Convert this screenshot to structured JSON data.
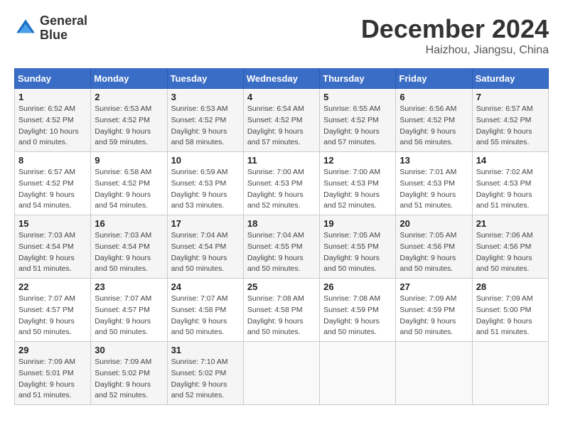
{
  "header": {
    "logo_line1": "General",
    "logo_line2": "Blue",
    "month": "December 2024",
    "location": "Haizhou, Jiangsu, China"
  },
  "days_of_week": [
    "Sunday",
    "Monday",
    "Tuesday",
    "Wednesday",
    "Thursday",
    "Friday",
    "Saturday"
  ],
  "weeks": [
    [
      {
        "day": "1",
        "sunrise": "6:52 AM",
        "sunset": "4:52 PM",
        "daylight": "10 hours and 0 minutes."
      },
      {
        "day": "2",
        "sunrise": "6:53 AM",
        "sunset": "4:52 PM",
        "daylight": "9 hours and 59 minutes."
      },
      {
        "day": "3",
        "sunrise": "6:53 AM",
        "sunset": "4:52 PM",
        "daylight": "9 hours and 58 minutes."
      },
      {
        "day": "4",
        "sunrise": "6:54 AM",
        "sunset": "4:52 PM",
        "daylight": "9 hours and 57 minutes."
      },
      {
        "day": "5",
        "sunrise": "6:55 AM",
        "sunset": "4:52 PM",
        "daylight": "9 hours and 57 minutes."
      },
      {
        "day": "6",
        "sunrise": "6:56 AM",
        "sunset": "4:52 PM",
        "daylight": "9 hours and 56 minutes."
      },
      {
        "day": "7",
        "sunrise": "6:57 AM",
        "sunset": "4:52 PM",
        "daylight": "9 hours and 55 minutes."
      }
    ],
    [
      {
        "day": "8",
        "sunrise": "6:57 AM",
        "sunset": "4:52 PM",
        "daylight": "9 hours and 54 minutes."
      },
      {
        "day": "9",
        "sunrise": "6:58 AM",
        "sunset": "4:52 PM",
        "daylight": "9 hours and 54 minutes."
      },
      {
        "day": "10",
        "sunrise": "6:59 AM",
        "sunset": "4:53 PM",
        "daylight": "9 hours and 53 minutes."
      },
      {
        "day": "11",
        "sunrise": "7:00 AM",
        "sunset": "4:53 PM",
        "daylight": "9 hours and 52 minutes."
      },
      {
        "day": "12",
        "sunrise": "7:00 AM",
        "sunset": "4:53 PM",
        "daylight": "9 hours and 52 minutes."
      },
      {
        "day": "13",
        "sunrise": "7:01 AM",
        "sunset": "4:53 PM",
        "daylight": "9 hours and 51 minutes."
      },
      {
        "day": "14",
        "sunrise": "7:02 AM",
        "sunset": "4:53 PM",
        "daylight": "9 hours and 51 minutes."
      }
    ],
    [
      {
        "day": "15",
        "sunrise": "7:03 AM",
        "sunset": "4:54 PM",
        "daylight": "9 hours and 51 minutes."
      },
      {
        "day": "16",
        "sunrise": "7:03 AM",
        "sunset": "4:54 PM",
        "daylight": "9 hours and 50 minutes."
      },
      {
        "day": "17",
        "sunrise": "7:04 AM",
        "sunset": "4:54 PM",
        "daylight": "9 hours and 50 minutes."
      },
      {
        "day": "18",
        "sunrise": "7:04 AM",
        "sunset": "4:55 PM",
        "daylight": "9 hours and 50 minutes."
      },
      {
        "day": "19",
        "sunrise": "7:05 AM",
        "sunset": "4:55 PM",
        "daylight": "9 hours and 50 minutes."
      },
      {
        "day": "20",
        "sunrise": "7:05 AM",
        "sunset": "4:56 PM",
        "daylight": "9 hours and 50 minutes."
      },
      {
        "day": "21",
        "sunrise": "7:06 AM",
        "sunset": "4:56 PM",
        "daylight": "9 hours and 50 minutes."
      }
    ],
    [
      {
        "day": "22",
        "sunrise": "7:07 AM",
        "sunset": "4:57 PM",
        "daylight": "9 hours and 50 minutes."
      },
      {
        "day": "23",
        "sunrise": "7:07 AM",
        "sunset": "4:57 PM",
        "daylight": "9 hours and 50 minutes."
      },
      {
        "day": "24",
        "sunrise": "7:07 AM",
        "sunset": "4:58 PM",
        "daylight": "9 hours and 50 minutes."
      },
      {
        "day": "25",
        "sunrise": "7:08 AM",
        "sunset": "4:58 PM",
        "daylight": "9 hours and 50 minutes."
      },
      {
        "day": "26",
        "sunrise": "7:08 AM",
        "sunset": "4:59 PM",
        "daylight": "9 hours and 50 minutes."
      },
      {
        "day": "27",
        "sunrise": "7:09 AM",
        "sunset": "4:59 PM",
        "daylight": "9 hours and 50 minutes."
      },
      {
        "day": "28",
        "sunrise": "7:09 AM",
        "sunset": "5:00 PM",
        "daylight": "9 hours and 51 minutes."
      }
    ],
    [
      {
        "day": "29",
        "sunrise": "7:09 AM",
        "sunset": "5:01 PM",
        "daylight": "9 hours and 51 minutes."
      },
      {
        "day": "30",
        "sunrise": "7:09 AM",
        "sunset": "5:02 PM",
        "daylight": "9 hours and 52 minutes."
      },
      {
        "day": "31",
        "sunrise": "7:10 AM",
        "sunset": "5:02 PM",
        "daylight": "9 hours and 52 minutes."
      },
      null,
      null,
      null,
      null
    ]
  ]
}
